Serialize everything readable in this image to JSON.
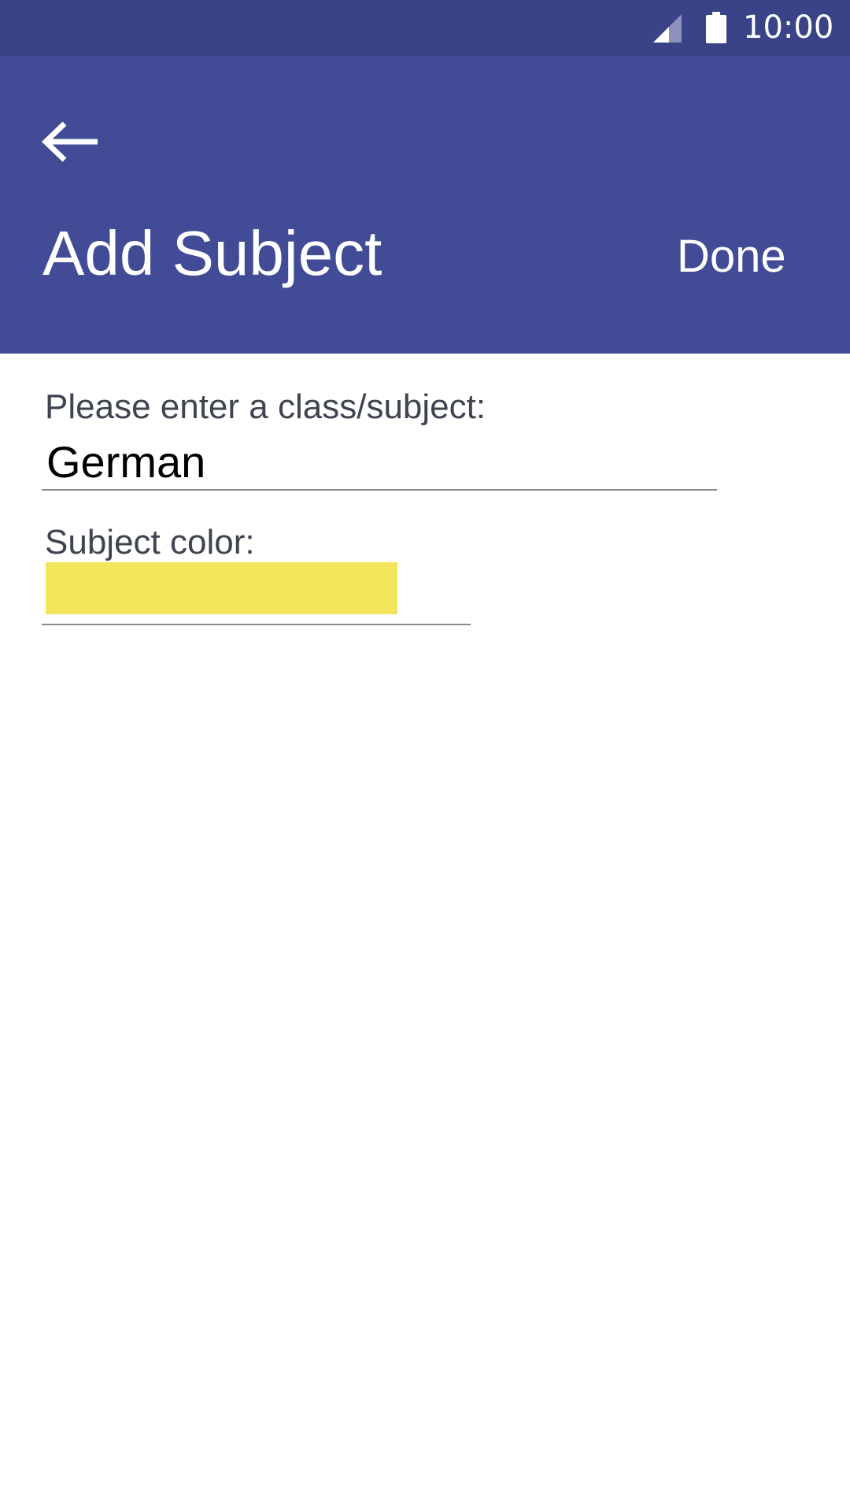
{
  "status_bar": {
    "time": "10:00",
    "icons": [
      "signal-icon",
      "battery-icon"
    ]
  },
  "app_bar": {
    "back_icon": "arrow-left-icon",
    "title": "Add Subject",
    "done_label": "Done"
  },
  "form": {
    "subject_label": "Please enter a class/subject:",
    "subject_value": "German",
    "color_label": "Subject color:",
    "color_value": "#f2e55a"
  },
  "colors": {
    "status_bar": "#3a4388",
    "app_bar": "#414b96",
    "label_text": "#3e4450",
    "swatch": "#f2e55a"
  }
}
